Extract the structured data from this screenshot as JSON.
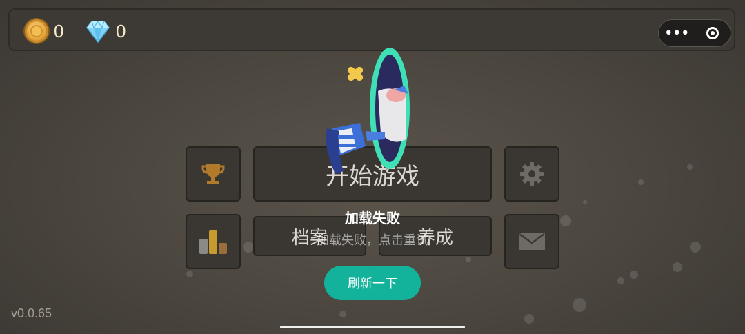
{
  "currency": {
    "coins": "0",
    "gems": "0"
  },
  "capsule": {
    "more": "•••"
  },
  "menu": {
    "start_label": "开始游戏",
    "archive_label": "档案",
    "develop_label": "养成"
  },
  "error": {
    "title": "加载失败",
    "message": "加载失败，点击重试",
    "refresh_label": "刷新一下"
  },
  "version": "v0.0.65",
  "colors": {
    "accent": "#13b39b",
    "portal": "#3fe0b5",
    "background": "#4a453e"
  }
}
